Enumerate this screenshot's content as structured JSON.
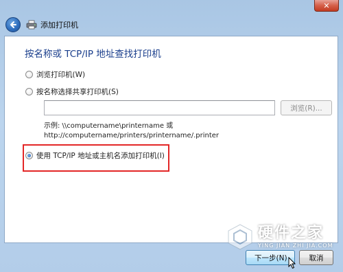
{
  "window": {
    "title": "添加打印机",
    "close_glyph": "✕"
  },
  "content": {
    "heading": "按名称或 TCP/IP 地址查找打印机"
  },
  "options": [
    {
      "label": "浏览打印机(W)",
      "checked": false
    },
    {
      "label": "按名称选择共享打印机(S)",
      "checked": false
    },
    {
      "label": "使用 TCP/IP 地址或主机名添加打印机(I)",
      "checked": true
    }
  ],
  "shared_printer": {
    "input_value": "",
    "browse_label": "浏览(R)...",
    "example_line1": "示例: \\\\computername\\printername 或",
    "example_line2": "http://computername/printers/printername/.printer"
  },
  "footer": {
    "next_label": "下一步(N)",
    "cancel_label": "取消"
  },
  "watermark": {
    "main": "硬件之家",
    "sub": "YING JIAN ZHI JIA.COM"
  },
  "colors": {
    "heading": "#1a3e8c",
    "highlight": "#e32626",
    "window_frame": "#b3cde9"
  }
}
